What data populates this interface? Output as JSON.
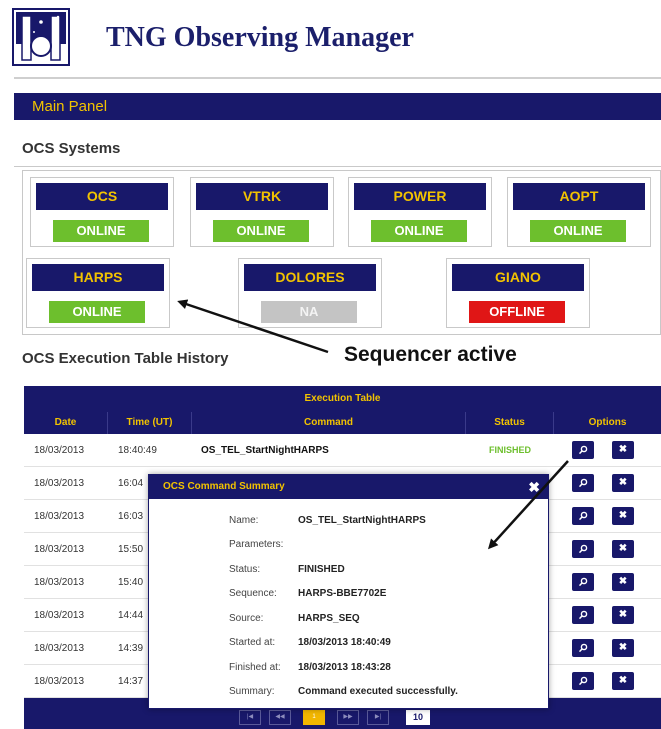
{
  "header": {
    "title": "TNG Observing Manager"
  },
  "main_panel": {
    "label": "Main Panel"
  },
  "ocs_systems": {
    "title": "OCS Systems",
    "systems": [
      {
        "name": "OCS",
        "status": "ONLINE"
      },
      {
        "name": "VTRK",
        "status": "ONLINE"
      },
      {
        "name": "POWER",
        "status": "ONLINE"
      },
      {
        "name": "AOPT",
        "status": "ONLINE"
      },
      {
        "name": "HARPS",
        "status": "ONLINE"
      },
      {
        "name": "DOLORES",
        "status": "NA"
      },
      {
        "name": "GIANO",
        "status": "OFFLINE"
      }
    ]
  },
  "annotation": {
    "text": "Sequencer active"
  },
  "history": {
    "title": "OCS Execution Table History",
    "table_title": "Execution Table",
    "columns": [
      "Date",
      "Time (UT)",
      "Command",
      "Status",
      "Options"
    ],
    "rows": [
      {
        "date": "18/03/2013",
        "time": "18:40:49",
        "command": "OS_TEL_StartNightHARPS",
        "status": "FINISHED"
      },
      {
        "date": "18/03/2013",
        "time": "16:04"
      },
      {
        "date": "18/03/2013",
        "time": "16:03"
      },
      {
        "date": "18/03/2013",
        "time": "15:50"
      },
      {
        "date": "18/03/2013",
        "time": "15:40"
      },
      {
        "date": "18/03/2013",
        "time": "14:44"
      },
      {
        "date": "18/03/2013",
        "time": "14:39"
      },
      {
        "date": "18/03/2013",
        "time": "14:37"
      }
    ],
    "pager": {
      "current_page": "1",
      "page_size": "10"
    }
  },
  "modal": {
    "title": "OCS Command Summary",
    "close_glyph": "✖",
    "fields": [
      {
        "label": "Name:",
        "value": "OS_TEL_StartNightHARPS"
      },
      {
        "label": "Parameters:",
        "value": ""
      },
      {
        "label": "Status:",
        "value": "FINISHED"
      },
      {
        "label": "Sequence:",
        "value": "HARPS-BBE7702E"
      },
      {
        "label": "Source:",
        "value": "HARPS_SEQ"
      },
      {
        "label": "Started at:",
        "value": "18/03/2013 18:40:49"
      },
      {
        "label": "Finished at:",
        "value": "18/03/2013 18:43:28"
      },
      {
        "label": "Summary:",
        "value": "Command executed successfully."
      }
    ]
  },
  "icons": {
    "view": "search-icon",
    "delete": "close-icon"
  },
  "colors": {
    "navy": "#18186a",
    "gold": "#f2c300",
    "online": "#6dbf2d",
    "offline": "#e01616",
    "na": "#c4c4c4"
  }
}
